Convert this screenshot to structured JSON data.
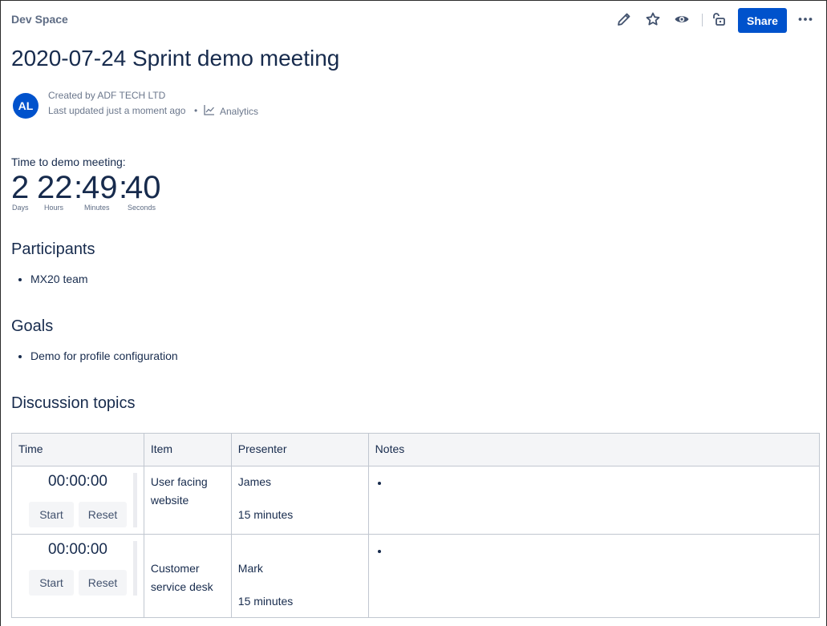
{
  "header": {
    "breadcrumb": "Dev Space",
    "share_label": "Share",
    "icons": [
      "pencil-icon",
      "star-icon",
      "eye-icon",
      "unlock-icon",
      "more-icon"
    ]
  },
  "page": {
    "title": "2020-07-24 Sprint demo meeting"
  },
  "byline": {
    "avatar_initials": "AL",
    "created": "Created by ADF TECH LTD",
    "updated": "Last updated just a moment ago",
    "separator": "•",
    "analytics_label": "Analytics"
  },
  "countdown": {
    "label": "Time to demo meeting:",
    "days": "2",
    "hours": "22",
    "minutes": "49",
    "seconds": "40",
    "colon": ":",
    "days_label": "Days",
    "hours_label": "Hours",
    "minutes_label": "Minutes",
    "seconds_label": "Seconds"
  },
  "participants": {
    "heading": "Participants",
    "items": [
      "MX20 team"
    ]
  },
  "goals": {
    "heading": "Goals",
    "items": [
      "Demo for profile configuration"
    ]
  },
  "discussion": {
    "heading": "Discussion topics",
    "columns": [
      "Time",
      "Item",
      "Presenter",
      "Notes"
    ],
    "rows": [
      {
        "timer": "00:00:00",
        "start_label": "Start",
        "reset_label": "Reset",
        "item_line1": "User facing",
        "item_line2": "website",
        "presenter": "James",
        "duration": "15 minutes"
      },
      {
        "timer": "00:00:00",
        "start_label": "Start",
        "reset_label": "Reset",
        "item_line1": "Customer",
        "item_line2": "service desk",
        "presenter": "Mark",
        "duration": "15 minutes"
      }
    ]
  },
  "colors": {
    "accent": "#0052CC",
    "text": "#172B4D",
    "muted": "#6B778C",
    "table_header_bg": "#F4F5F7",
    "border": "#C1C7D0"
  }
}
